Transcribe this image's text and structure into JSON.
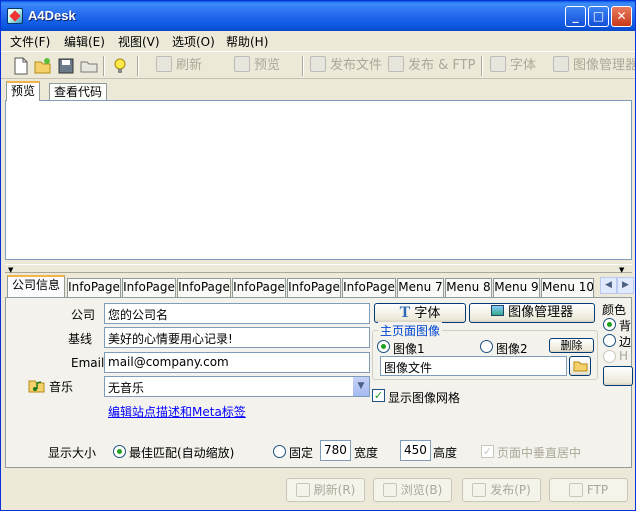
{
  "window": {
    "title": "A4Desk",
    "minimize_glyph": "_",
    "maximize_glyph": "□",
    "close_glyph": "✕"
  },
  "menu": [
    "文件(F)",
    "编辑(E)",
    "视图(V)",
    "选项(O)",
    "帮助(H)"
  ],
  "toolbar": {
    "refresh": "刷新",
    "preview": "预览",
    "publish_file": "发布文件",
    "publish_ftp": "发布 & FTP",
    "font": "字体",
    "image_manager": "图像管理器"
  },
  "preview_tabs": [
    "预览",
    "查看代码"
  ],
  "panel_tabs": [
    "公司信息",
    "InfoPage",
    "InfoPage",
    "InfoPage",
    "InfoPage",
    "InfoPage",
    "InfoPage",
    "Menu 7",
    "Menu 8",
    "Menu 9",
    "Menu 10"
  ],
  "form": {
    "company_label": "公司",
    "company_value": "您的公司名",
    "slogan_label": "基线",
    "slogan_value": "美好的心情要用心记录!",
    "email_label": "Email",
    "email_value": "mail@company.com",
    "music_label": "音乐",
    "music_value": "无音乐",
    "meta_link": "编辑站点描述和Meta标签"
  },
  "right": {
    "font_button": "字体",
    "image_manager_button": "图像管理器",
    "group_title": "主页面图像",
    "image1": "图像1",
    "image2": "图像2",
    "delete_button": "删除",
    "image_file_value": "图像文件",
    "show_grid": "显示图像网格",
    "color_label": "颜色",
    "color_opt1": "背",
    "color_opt2": "边",
    "color_opt3": "H"
  },
  "display": {
    "size_label": "显示大小",
    "best_fit": "最佳匹配(自动缩放)",
    "fixed": "固定",
    "width_value": "780",
    "width_label": "宽度",
    "height_value": "450",
    "height_label": "高度",
    "center_label": "页面中垂直居中"
  },
  "bottom": {
    "refresh": "刷新(R)",
    "browse": "浏览(B)",
    "publish": "发布(P)",
    "ftp": "FTP"
  }
}
